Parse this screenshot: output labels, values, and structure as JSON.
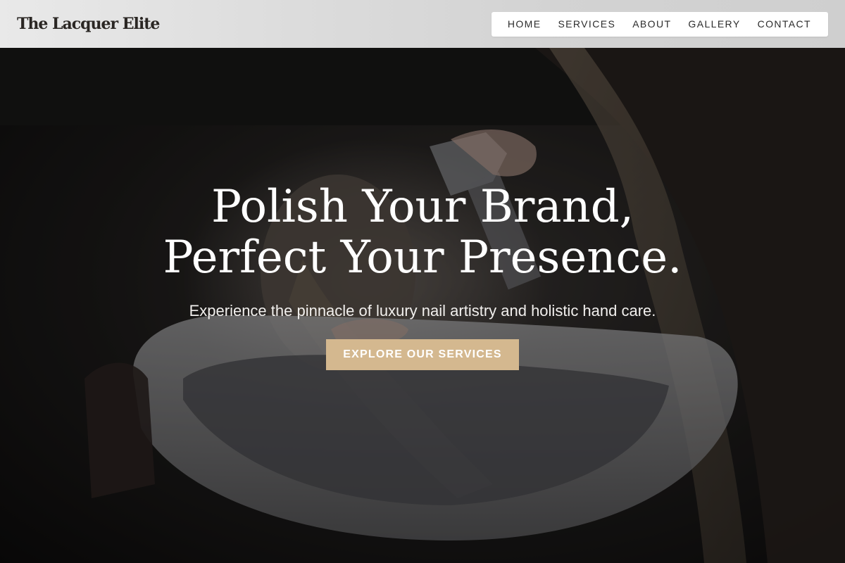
{
  "brand": {
    "name": "The Lacquer Elite"
  },
  "nav": {
    "items": [
      {
        "label": "HOME"
      },
      {
        "label": "SERVICES"
      },
      {
        "label": "ABOUT"
      },
      {
        "label": "GALLERY"
      },
      {
        "label": "CONTACT"
      }
    ]
  },
  "hero": {
    "title_line1": "Polish Your Brand,",
    "title_line2": "Perfect Your Presence.",
    "subtitle": "Experience the pinnacle of luxury nail artistry and holistic hand care.",
    "cta_label": "EXPLORE OUR SERVICES"
  },
  "colors": {
    "accent": "#d4b88f",
    "header_bg": "#dcdcdc",
    "text_dark": "#2a2623",
    "hero_text": "#ffffff"
  }
}
